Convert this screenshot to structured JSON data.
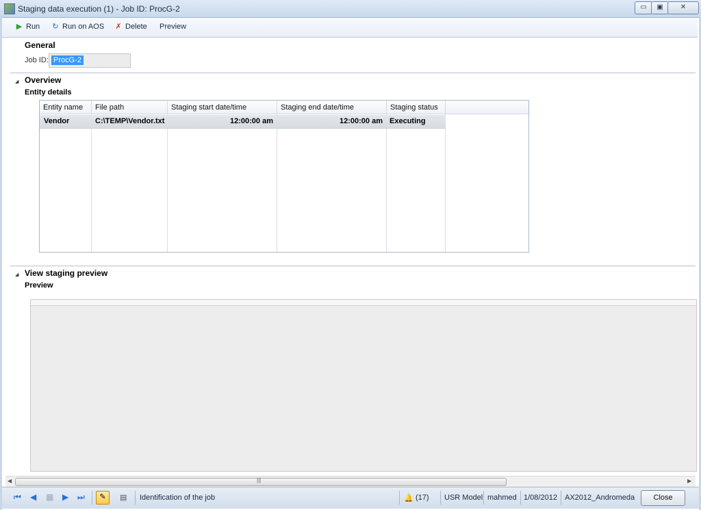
{
  "window": {
    "title": "Staging data execution (1) - Job ID: ProcG-2",
    "controls": {
      "minimize": "▭",
      "maximize": "▣",
      "close": "✕"
    }
  },
  "toolbar": {
    "run": "Run",
    "run_on_aos": "Run on AOS",
    "delete": "Delete",
    "preview": "Preview"
  },
  "general": {
    "title": "General",
    "job_id_label": "Job ID:",
    "job_id_value": "ProcG-2"
  },
  "overview": {
    "title": "Overview",
    "subtitle": "Entity details",
    "columns": [
      "Entity name",
      "File path",
      "Staging start date/time",
      "Staging end date/time",
      "Staging status"
    ],
    "rows": [
      [
        "Vendor",
        "C:\\TEMP\\Vendor.txt",
        "12:00:00 am",
        "12:00:00 am",
        "Executing"
      ]
    ]
  },
  "staging_preview": {
    "title": "View staging preview",
    "subtitle": "Preview"
  },
  "statusbar": {
    "help_text": "Identification of the job",
    "notifications": "(17)",
    "model": "USR Model",
    "user": "mahmed",
    "date": "1/08/2012",
    "instance": "AX2012_Andromeda",
    "close_label": "Close"
  },
  "colors": {
    "accent": "#2a6fd1",
    "selection": "#3399ff",
    "toolbar_bg": "#eef3f9",
    "run_icon": "#2aa52a"
  },
  "icons": [
    "app-icon",
    "run-icon",
    "run-on-aos-icon",
    "delete-icon",
    "collapse-icon",
    "first-record-icon",
    "previous-record-icon",
    "grid-icon",
    "next-record-icon",
    "last-record-icon",
    "edit-icon",
    "document-icon",
    "notification-bell-icon"
  ]
}
